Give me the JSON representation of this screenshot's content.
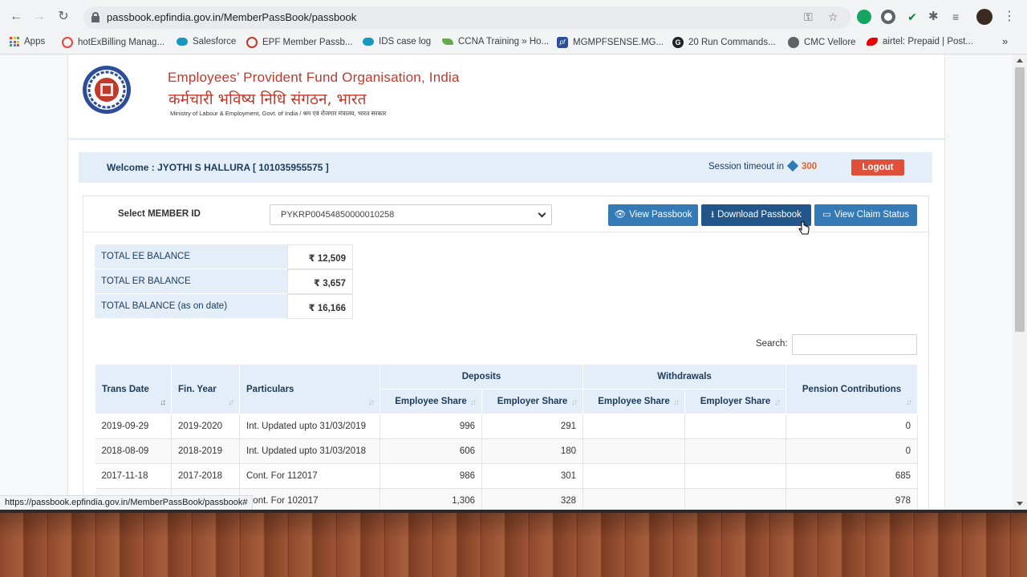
{
  "browser": {
    "url": "passbook.epfindia.gov.in/MemberPassBook/passbook",
    "status_url": "https://passbook.epfindia.gov.in/MemberPassBook/passbook#",
    "bookmarks": [
      {
        "label": "Apps",
        "icon": "apps-grid-icon"
      },
      {
        "label": "hotExBilling Manag...",
        "icon": "globe-icon",
        "color": "#e8453c"
      },
      {
        "label": "Salesforce",
        "icon": "cloud-icon",
        "color": "#1798c1"
      },
      {
        "label": "EPF Member Passb...",
        "icon": "epfo-icon",
        "color": "#c0392b"
      },
      {
        "label": "IDS case log",
        "icon": "cloud-icon",
        "color": "#1798c1"
      },
      {
        "label": "CCNA Training » Ho...",
        "icon": "leaf-icon",
        "color": "#6aa84f"
      },
      {
        "label": "MGMPFSENSE.MG...",
        "icon": "pf-icon",
        "color": "#2b4d9a"
      },
      {
        "label": "20 Run Commands...",
        "icon": "g-icon",
        "color": "#202124"
      },
      {
        "label": "CMC Vellore",
        "icon": "globe-icon",
        "color": "#5f6368"
      },
      {
        "label": "airtel: Prepaid | Post...",
        "icon": "airtel-icon",
        "color": "#e40000"
      }
    ]
  },
  "header": {
    "org_en": "Employees’ Provident Fund Organisation, India",
    "org_hi": "कर्मचारी भविष्य निधि संगठन, भारत",
    "ministry": "Ministry of Labour & Employment, Govt. of India / श्रम एवं रोजगार मंत्रालय, भारत सरकार"
  },
  "welcome": {
    "text": "Welcome : JYOTHI S HALLURA [ 101035955575 ]",
    "session_label": "Session timeout in",
    "session_count": "300",
    "logout": "Logout"
  },
  "member": {
    "label": "Select MEMBER ID",
    "selected": "PYKRP00454850000010258",
    "btn_view": "View Passbook",
    "btn_download": "Download Passbook",
    "btn_claim": "View Claim Status"
  },
  "balances": [
    {
      "label": "TOTAL EE BALANCE",
      "value": "₹ 12,509"
    },
    {
      "label": "TOTAL ER BALANCE",
      "value": "₹ 3,657"
    },
    {
      "label": "TOTAL BALANCE (as on date)",
      "value": "₹ 16,166"
    }
  ],
  "search": {
    "label": "Search:",
    "value": ""
  },
  "table": {
    "headers": {
      "trans_date": "Trans Date",
      "fin_year": "Fin. Year",
      "particulars": "Particulars",
      "deposits": "Deposits",
      "withdrawals": "Withdrawals",
      "pension": "Pension Contributions",
      "dep_employee": "Employee Share",
      "dep_employer": "Employer Share",
      "wd_employee": "Employee Share",
      "wd_employer": "Employer Share"
    },
    "rows": [
      {
        "date": "2019-09-29",
        "fy": "2019-2020",
        "particulars": "Int. Updated upto 31/03/2019",
        "dep_ee": "996",
        "dep_er": "291",
        "wd_ee": "",
        "wd_er": "",
        "pension": "0"
      },
      {
        "date": "2018-08-09",
        "fy": "2018-2019",
        "particulars": "Int. Updated upto 31/03/2018",
        "dep_ee": "606",
        "dep_er": "180",
        "wd_ee": "",
        "wd_er": "",
        "pension": "0"
      },
      {
        "date": "2017-11-18",
        "fy": "2017-2018",
        "particulars": "Cont. For 112017",
        "dep_ee": "986",
        "dep_er": "301",
        "wd_ee": "",
        "wd_er": "",
        "pension": "685"
      },
      {
        "date": "",
        "fy": "",
        "particulars": "Cont. For 102017",
        "dep_ee": "1,306",
        "dep_er": "328",
        "wd_ee": "",
        "wd_er": "",
        "pension": "978"
      }
    ]
  }
}
